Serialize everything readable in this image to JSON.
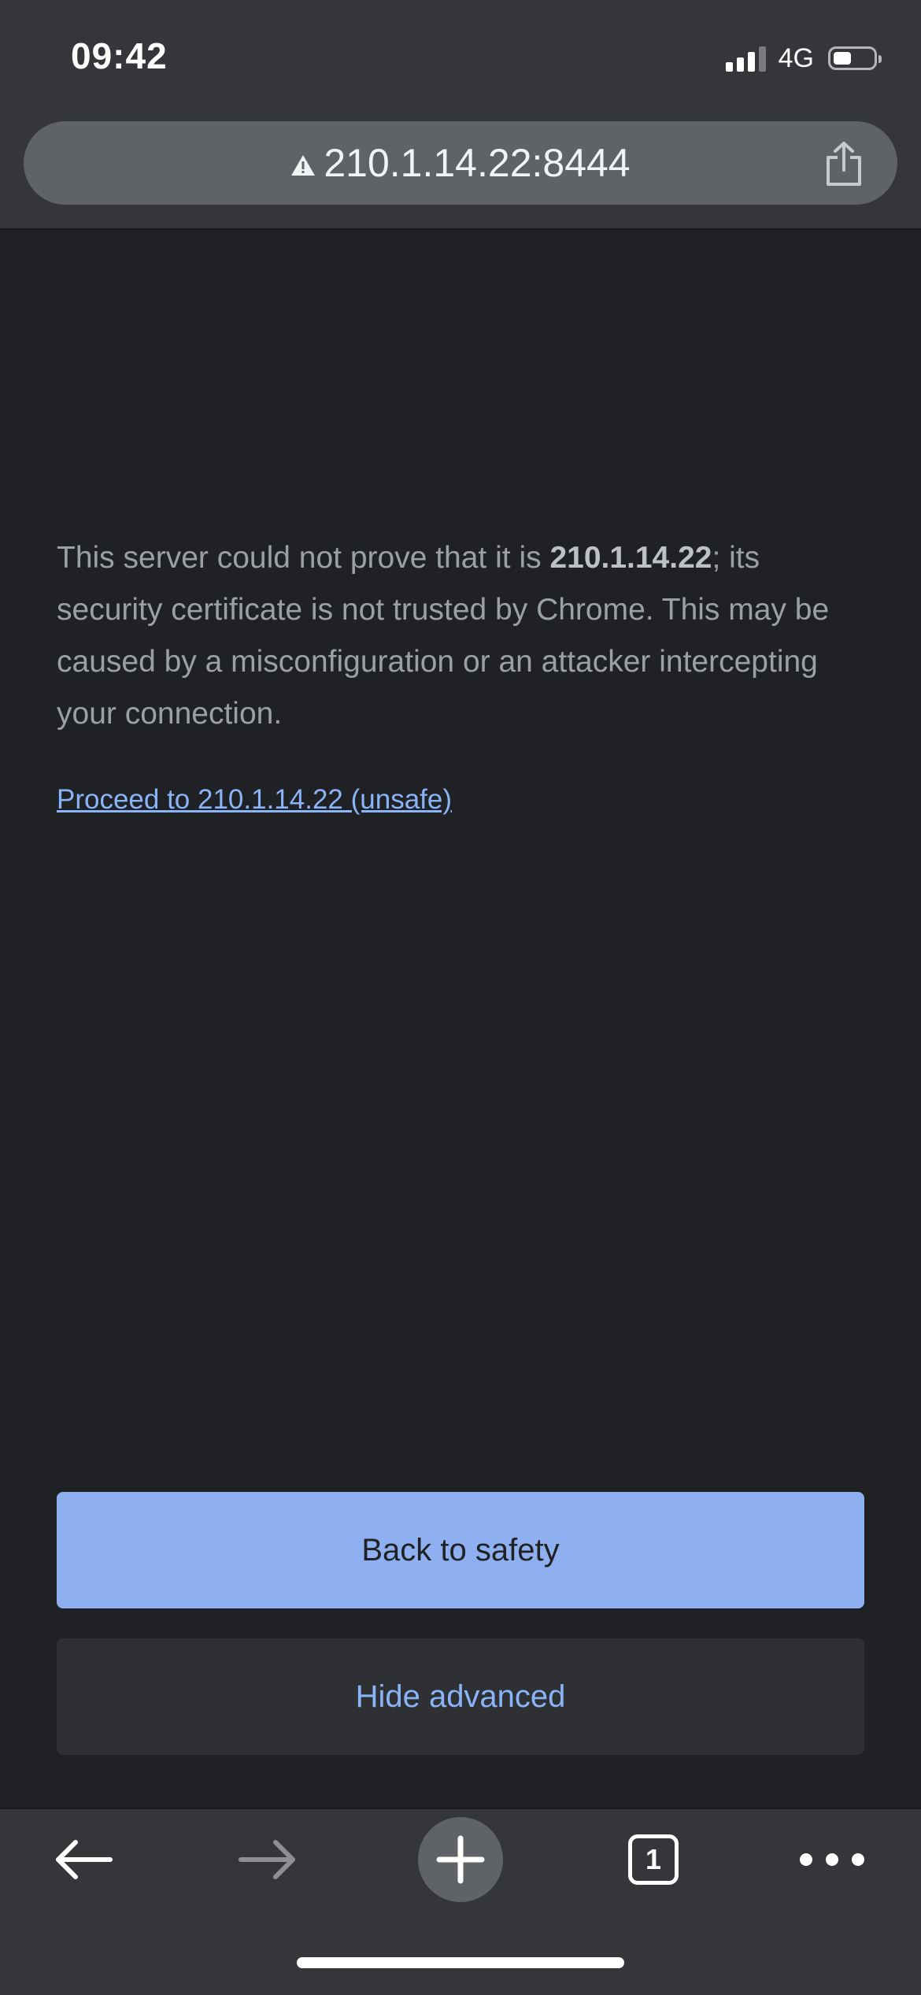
{
  "status_bar": {
    "time": "09:42",
    "network": "4G",
    "battery_level": 0.45
  },
  "url_bar": {
    "url": "210.1.14.22:8444",
    "security_icon": "warning-triangle-icon",
    "share_icon": "share-icon"
  },
  "page": {
    "message_before": "This server could not prove that it is ",
    "message_host": "210.1.14.22",
    "message_after": "; its security certificate is not trusted by Chrome. This may be caused by a misconfiguration or an attacker intercepting your connection.",
    "proceed_link": "Proceed to 210.1.14.22 (unsafe)",
    "back_button": "Back to safety",
    "hide_button": "Hide advanced"
  },
  "toolbar": {
    "back_icon": "back-arrow-icon",
    "forward_icon": "forward-arrow-icon",
    "new_tab_icon": "plus-icon",
    "tab_count": "1",
    "menu_icon": "more-icon"
  },
  "colors": {
    "background": "#202124",
    "chrome": "#35363a",
    "primary_button": "#8fb0f0",
    "link": "#8ab4f8"
  }
}
